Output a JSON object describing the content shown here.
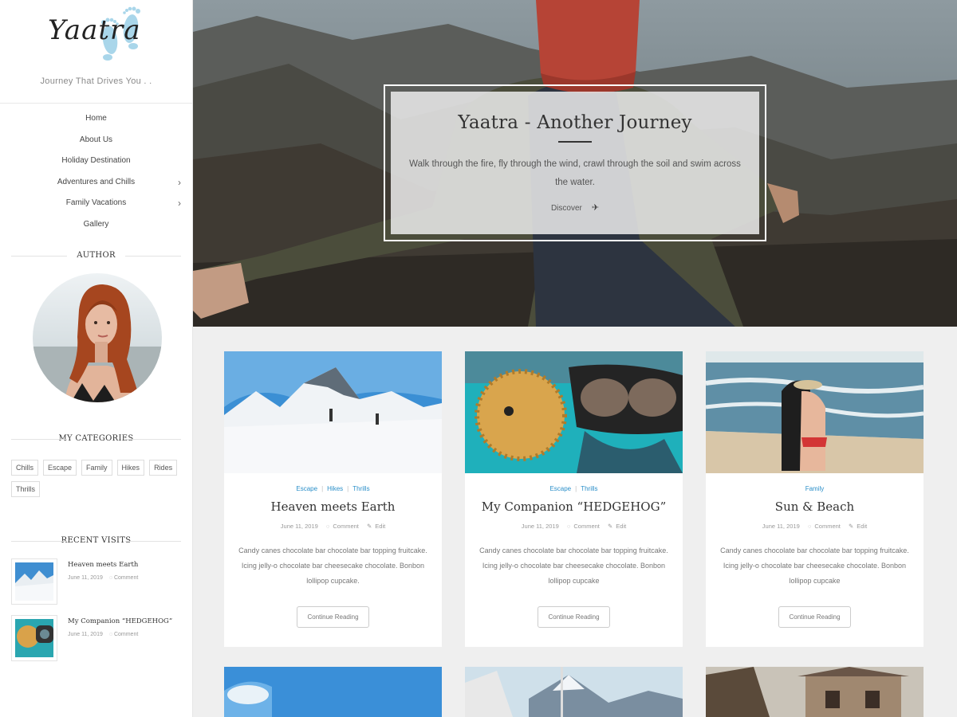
{
  "site": {
    "logo_text": "Yaatra",
    "tagline": "Journey That Drives You . ."
  },
  "menu": [
    {
      "label": "Home",
      "has_submenu": false
    },
    {
      "label": "About Us",
      "has_submenu": false
    },
    {
      "label": "Holiday Destination",
      "has_submenu": false
    },
    {
      "label": "Adventures and Chills",
      "has_submenu": true
    },
    {
      "label": "Family Vacations",
      "has_submenu": true
    },
    {
      "label": "Gallery",
      "has_submenu": false
    }
  ],
  "widgets": {
    "author_title": "AUTHOR",
    "categories_title": "MY CATEGORIES",
    "categories": [
      "Chills",
      "Escape",
      "Family",
      "Hikes",
      "Rides",
      "Thrills"
    ],
    "recent_title": "RECENT VISITS",
    "recent": [
      {
        "title": "Heaven meets Earth",
        "date": "June 11, 2019",
        "comment": "Comment"
      },
      {
        "title": "My Companion “HEDGEHOG”",
        "date": "June 11, 2019",
        "comment": "Comment"
      }
    ]
  },
  "hero": {
    "title": "Yaatra - Another Journey",
    "description": "Walk through the fire, fly through the wind, crawl through the soil and swim across the water.",
    "button": "Discover"
  },
  "posts": [
    {
      "cats": [
        "Escape",
        "Hikes",
        "Thrills"
      ],
      "title": "Heaven meets Earth",
      "date": "June 11, 2019",
      "comment": "Comment",
      "edit": "Edit",
      "excerpt": "Candy canes chocolate bar chocolate bar topping fruitcake. Icing jelly-o chocolate bar cheesecake chocolate. Bonbon lollipop cupcake.",
      "button": "Continue Reading"
    },
    {
      "cats": [
        "Escape",
        "Thrills"
      ],
      "title": "My Companion “HEDGEHOG”",
      "date": "June 11, 2019",
      "comment": "Comment",
      "edit": "Edit",
      "excerpt": "Candy canes chocolate bar chocolate bar topping fruitcake. Icing jelly-o chocolate bar cheesecake chocolate. Bonbon lollipop cupcake",
      "button": "Continue Reading"
    },
    {
      "cats": [
        "Family"
      ],
      "title": "Sun & Beach",
      "date": "June 11, 2019",
      "comment": "Comment",
      "edit": "Edit",
      "excerpt": "Candy canes chocolate bar chocolate bar topping fruitcake. Icing jelly-o chocolate bar cheesecake chocolate. Bonbon lollipop cupcake",
      "button": "Continue Reading"
    }
  ],
  "colors": {
    "accent": "#2b8fc9",
    "background": "#efefef",
    "logo_feet": "#a9d6ea"
  }
}
